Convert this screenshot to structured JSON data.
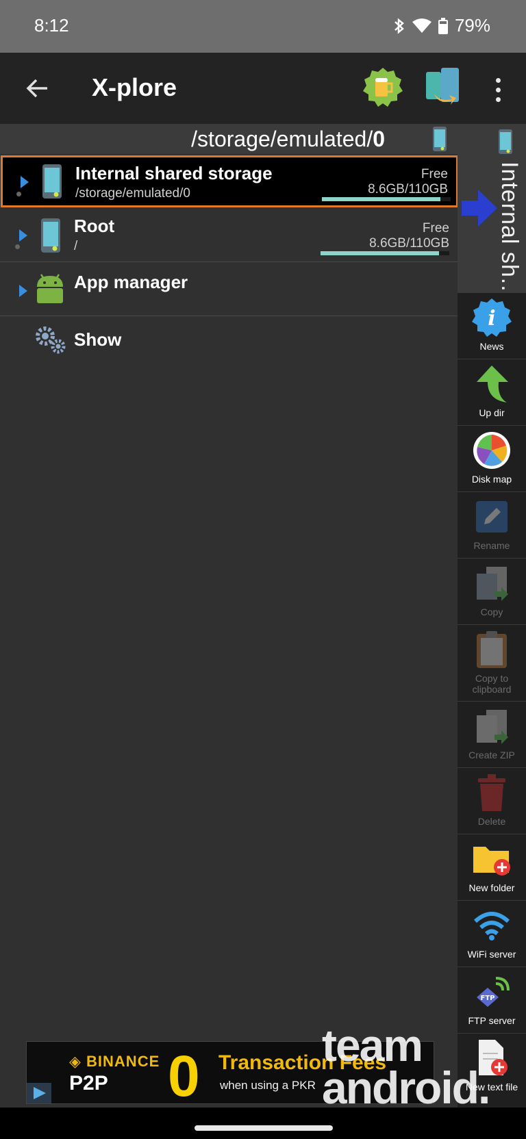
{
  "status": {
    "time": "8:12",
    "battery": "79%"
  },
  "appbar": {
    "title": "X-plore"
  },
  "path": {
    "prefix": "/storage/emulated/",
    "suffix": "0"
  },
  "rows": [
    {
      "title": "Internal shared storage",
      "subtitle": "/storage/emulated/0",
      "free_label": "Free",
      "size": "8.6GB/110GB",
      "used_fraction": 0.92
    },
    {
      "title": "Root",
      "subtitle": "/",
      "free_label": "Free",
      "size": "8.6GB/110GB",
      "used_fraction": 0.92
    },
    {
      "title": "App manager"
    },
    {
      "title": "Show"
    }
  ],
  "side_pane": {
    "label": "Internal sh..."
  },
  "toolbar": [
    {
      "label": "News",
      "icon": "info-icon",
      "enabled": true
    },
    {
      "label": "Up dir",
      "icon": "up-arrow-icon",
      "enabled": true
    },
    {
      "label": "Disk map",
      "icon": "pie-chart-icon",
      "enabled": true
    },
    {
      "label": "Rename",
      "icon": "pencil-icon",
      "enabled": false
    },
    {
      "label": "Copy",
      "icon": "copy-icon",
      "enabled": false
    },
    {
      "label": "Copy to clipboard",
      "icon": "clipboard-icon",
      "enabled": false
    },
    {
      "label": "Create ZIP",
      "icon": "zip-icon",
      "enabled": false
    },
    {
      "label": "Delete",
      "icon": "trash-icon",
      "enabled": false
    },
    {
      "label": "New folder",
      "icon": "folder-plus-icon",
      "enabled": true
    },
    {
      "label": "WiFi server",
      "icon": "wifi-icon",
      "enabled": true
    },
    {
      "label": "FTP server",
      "icon": "ftp-icon",
      "enabled": true
    },
    {
      "label": "New text file",
      "icon": "file-plus-icon",
      "enabled": true
    }
  ],
  "ad": {
    "brand": "◈ BINANCE",
    "product": "P2P",
    "zero": "0",
    "headline": "Transaction Fees",
    "subline": "when using a PKR"
  },
  "watermark": {
    "line1": "team",
    "line2": "android."
  },
  "colors": {
    "accent_border": "#e07a2a",
    "bar_fill": "#8fd4cb",
    "expand_arrow": "#3a8ee0"
  }
}
